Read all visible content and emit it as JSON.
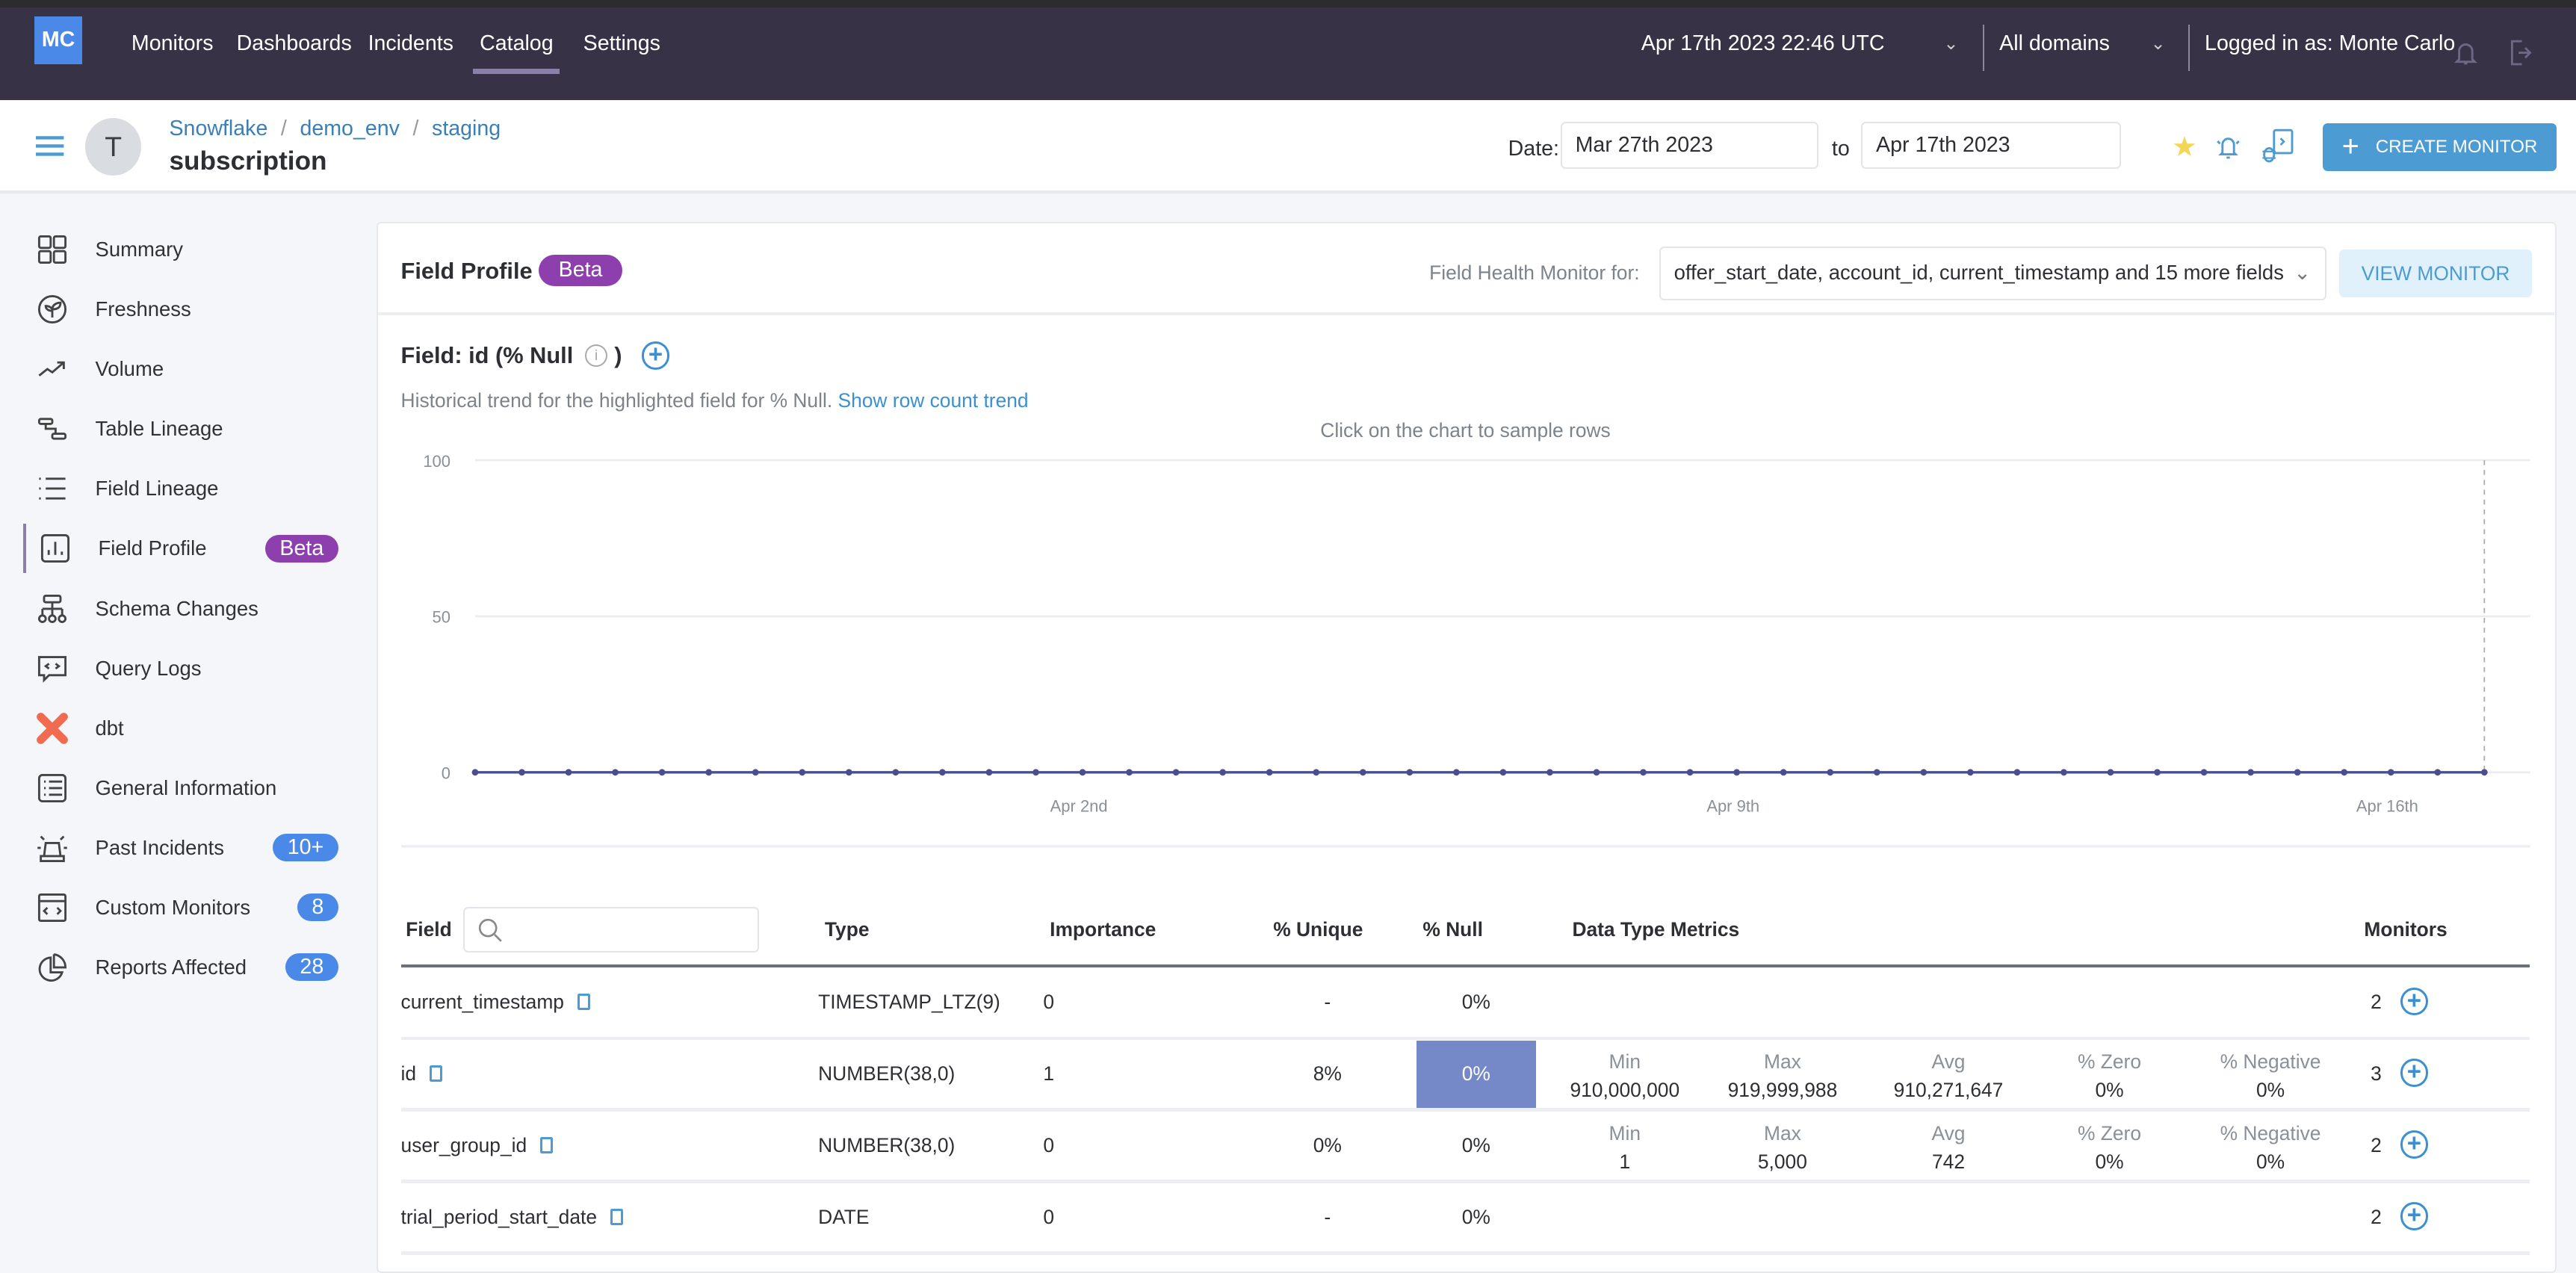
{
  "nav": {
    "logo": "MC",
    "items": [
      "Monitors",
      "Dashboards",
      "Incidents",
      "Catalog",
      "Settings"
    ],
    "active": "Catalog",
    "datetime": "Apr 17th 2023 22:46 UTC",
    "domain": "All domains",
    "logged_in": "Logged in as: Monte Carlo"
  },
  "header": {
    "breadcrumb": [
      "Snowflake",
      "demo_env",
      "staging"
    ],
    "title": "subscription",
    "avatar": "T",
    "date_label": "Date:",
    "date_from": "Mar 27th 2023",
    "to_label": "to",
    "date_to": "Apr 17th 2023",
    "create_monitor": "CREATE MONITOR"
  },
  "sidebar": {
    "items": [
      {
        "label": "Summary",
        "icon": "grid-icon"
      },
      {
        "label": "Freshness",
        "icon": "leaf-icon"
      },
      {
        "label": "Volume",
        "icon": "trend-icon"
      },
      {
        "label": "Table Lineage",
        "icon": "lineage-icon"
      },
      {
        "label": "Field Lineage",
        "icon": "list-icon"
      },
      {
        "label": "Field Profile",
        "icon": "bar-chart-icon",
        "badge": "Beta",
        "active": true
      },
      {
        "label": "Schema Changes",
        "icon": "schema-icon"
      },
      {
        "label": "Query Logs",
        "icon": "code-bubble-icon"
      },
      {
        "label": "dbt",
        "icon": "dbt-icon"
      },
      {
        "label": "General Information",
        "icon": "info-list-icon"
      },
      {
        "label": "Past Incidents",
        "icon": "siren-icon",
        "badge": "10+"
      },
      {
        "label": "Custom Monitors",
        "icon": "code-window-icon",
        "badge": "8"
      },
      {
        "label": "Reports Affected",
        "icon": "pie-icon",
        "badge": "28"
      }
    ]
  },
  "card": {
    "title": "Field Profile",
    "badge": "Beta",
    "health_label": "Field Health Monitor for:",
    "health_value": "offer_start_date, account_id, current_timestamp and 15 more fields",
    "view_monitor": "VIEW MONITOR",
    "field_title": "Field: id (% Null",
    "field_title_close": ")",
    "desc": "Historical trend for the highlighted field for % Null.",
    "desc_link": "Show row count trend",
    "chart_hint": "Click on the chart to sample rows"
  },
  "chart_data": {
    "type": "line",
    "ylim": [
      0,
      100
    ],
    "yticks": [
      "0",
      "50",
      "100"
    ],
    "grid": true,
    "color": "#4a4f8c",
    "xticks": [
      {
        "x": "2023-04-02T00:00",
        "label": "Apr 2nd"
      },
      {
        "x": "2023-04-09T00:00",
        "label": "Apr 9th"
      },
      {
        "x": "2023-04-16T00:00",
        "label": "Apr 16th"
      }
    ],
    "x": [
      "2023-03-26T18:00",
      "2023-03-27T06:00",
      "2023-03-27T18:00",
      "2023-03-28T06:00",
      "2023-03-28T18:00",
      "2023-03-29T06:00",
      "2023-03-29T18:00",
      "2023-03-30T06:00",
      "2023-03-30T18:00",
      "2023-03-31T06:00",
      "2023-03-31T18:00",
      "2023-04-01T06:00",
      "2023-04-01T18:00",
      "2023-04-02T06:00",
      "2023-04-02T18:00",
      "2023-04-03T06:00",
      "2023-04-03T18:00",
      "2023-04-04T06:00",
      "2023-04-04T18:00",
      "2023-04-05T06:00",
      "2023-04-05T18:00",
      "2023-04-06T06:00",
      "2023-04-06T18:00",
      "2023-04-07T06:00",
      "2023-04-07T18:00",
      "2023-04-08T06:00",
      "2023-04-08T18:00",
      "2023-04-09T06:00",
      "2023-04-09T18:00",
      "2023-04-10T06:00",
      "2023-04-10T18:00",
      "2023-04-11T06:00",
      "2023-04-11T18:00",
      "2023-04-12T06:00",
      "2023-04-12T18:00",
      "2023-04-13T06:00",
      "2023-04-13T18:00",
      "2023-04-14T06:00",
      "2023-04-14T18:00",
      "2023-04-15T06:00",
      "2023-04-15T18:00",
      "2023-04-16T06:00",
      "2023-04-16T18:00",
      "2023-04-17T06:00"
    ],
    "values": [
      0,
      0,
      0,
      0,
      0,
      0,
      0,
      0,
      0,
      0,
      0,
      0,
      0,
      0,
      0,
      0,
      0,
      0,
      0,
      0,
      0,
      0,
      0,
      0,
      0,
      0,
      0,
      0,
      0,
      0,
      0,
      0,
      0,
      0,
      0,
      0,
      0,
      0,
      0,
      0,
      0,
      0,
      0,
      0
    ]
  },
  "table": {
    "headers": [
      "Field",
      "Type",
      "Importance",
      "% Unique",
      "% Null",
      "Data Type Metrics",
      "Monitors"
    ],
    "search_placeholder": "",
    "highlight_color": "#7589c9",
    "metric_labels": [
      "Min",
      "Max",
      "Avg",
      "% Zero",
      "% Negative"
    ],
    "rows": [
      {
        "field": "current_timestamp",
        "type": "TIMESTAMP_LTZ(9)",
        "importance": "0",
        "unique": "-",
        "null": "0%",
        "metrics": null,
        "monitors": "2"
      },
      {
        "field": "id",
        "type": "NUMBER(38,0)",
        "importance": "1",
        "unique": "8%",
        "null": "0%",
        "highlighted": true,
        "metrics": [
          "910,000,000",
          "919,999,988",
          "910,271,647",
          "0%",
          "0%"
        ],
        "monitors": "3"
      },
      {
        "field": "user_group_id",
        "type": "NUMBER(38,0)",
        "importance": "0",
        "unique": "0%",
        "null": "0%",
        "metrics": [
          "1",
          "5,000",
          "742",
          "0%",
          "0%"
        ],
        "monitors": "2"
      },
      {
        "field": "trial_period_start_date",
        "type": "DATE",
        "importance": "0",
        "unique": "-",
        "null": "0%",
        "metrics": null,
        "monitors": "2"
      }
    ]
  }
}
